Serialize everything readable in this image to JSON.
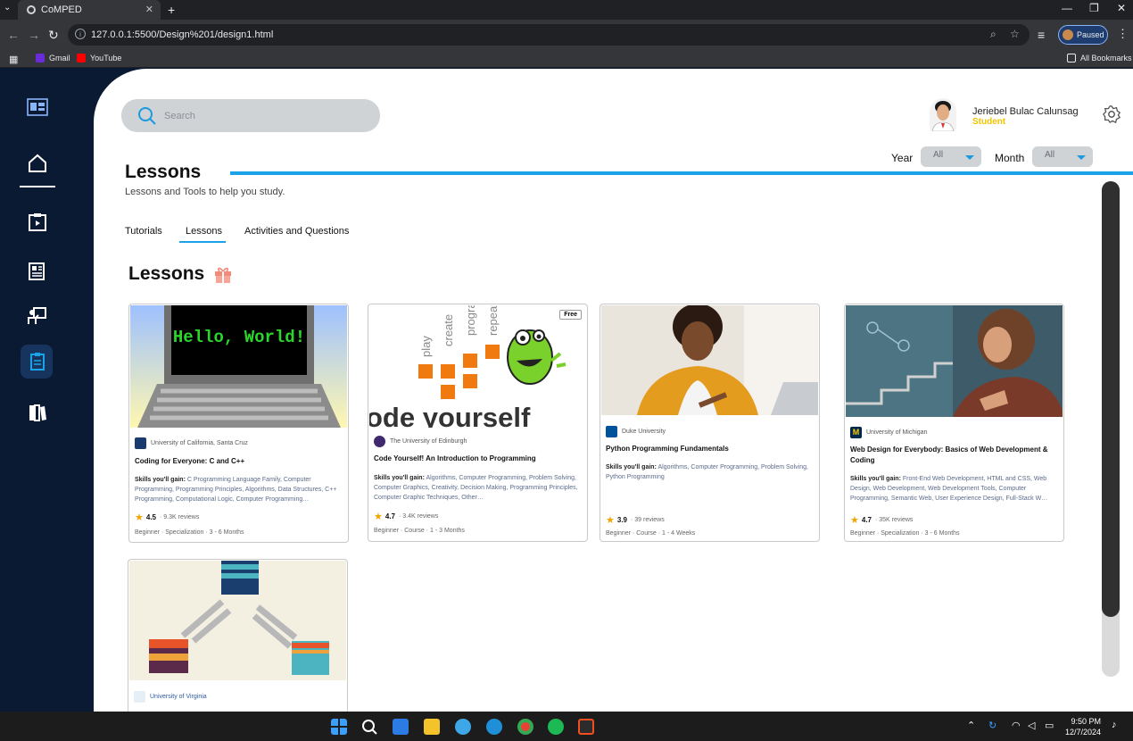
{
  "browser": {
    "tab_title": "CoMPED",
    "url": "127.0.0.1:5500/Design%201/design1.html",
    "profile_status": "Paused",
    "bookmarks": [
      "Gmail",
      "YouTube"
    ],
    "all_bookmarks": "All Bookmarks"
  },
  "header": {
    "search_placeholder": "Search",
    "user_name": "Jeriebel Bulac Calunsag",
    "user_role": "Student",
    "year_label": "Year",
    "year_value": "All",
    "month_label": "Month",
    "month_value": "All"
  },
  "page": {
    "title": "Lessons",
    "subtitle": "Lessons and Tools to help you study.",
    "tabs": [
      "Tutorials",
      "Lessons",
      "Activities and Questions"
    ],
    "active_tab": "Lessons",
    "section_title": "Lessons"
  },
  "cards": [
    {
      "org": "University of California, Santa Cruz",
      "title": "Coding for Everyone: C and C++",
      "skills_label": "Skills you'll gain:",
      "skills": "C Programming Language Family, Computer Programming, Programming Principles, Algorithms, Data Structures, C++ Programming, Computational Logic, Computer Programming…",
      "rating": "4.5",
      "reviews": "· 9.3K reviews",
      "meta": "Beginner · Specialization · 3 - 6 Months",
      "image_text": "Hello, World!"
    },
    {
      "org": "The University of Edinburgh",
      "title": "Code Yourself! An Introduction to Programming",
      "skills_label": "Skills you'll gain:",
      "skills": "Algorithms, Computer Programming, Problem Solving, Computer Graphics, Creativity, Decision Making, Programming Principles, Computer Graphic Techniques, Other…",
      "rating": "4.7",
      "reviews": "· 3.4K reviews",
      "meta": "Beginner · Course · 1 - 3 Months",
      "badge": "Free",
      "image_words": [
        "play",
        "create",
        "progra",
        "repeat"
      ],
      "image_text": "ode yourself"
    },
    {
      "org": "Duke University",
      "title": "Python Programming Fundamentals",
      "skills_label": "Skills you'll gain:",
      "skills": "Algorithms, Computer Programming, Problem Solving, Python Programming",
      "rating": "3.9",
      "reviews": "· 39 reviews",
      "meta": "Beginner · Course · 1 - 4 Weeks"
    },
    {
      "org": "University of Michigan",
      "title": "Web Design for Everybody: Basics of Web Development & Coding",
      "skills_label": "Skills you'll gain:",
      "skills": "Front-End Web Development, HTML and CSS, Web Design, Web Development, Web Development Tools, Computer Programming, Semantic Web, User Experience Design, Full-Stack W…",
      "rating": "4.7",
      "reviews": "· 35K reviews",
      "meta": "Beginner · Specialization · 3 - 6 Months"
    },
    {
      "org": "University of Virginia"
    }
  ],
  "taskbar": {
    "time": "9:50 PM",
    "date": "12/7/2024"
  },
  "colors": {
    "sidebar": "#0b1a33",
    "accent": "#1aa3e8",
    "role": "#f0c400"
  }
}
